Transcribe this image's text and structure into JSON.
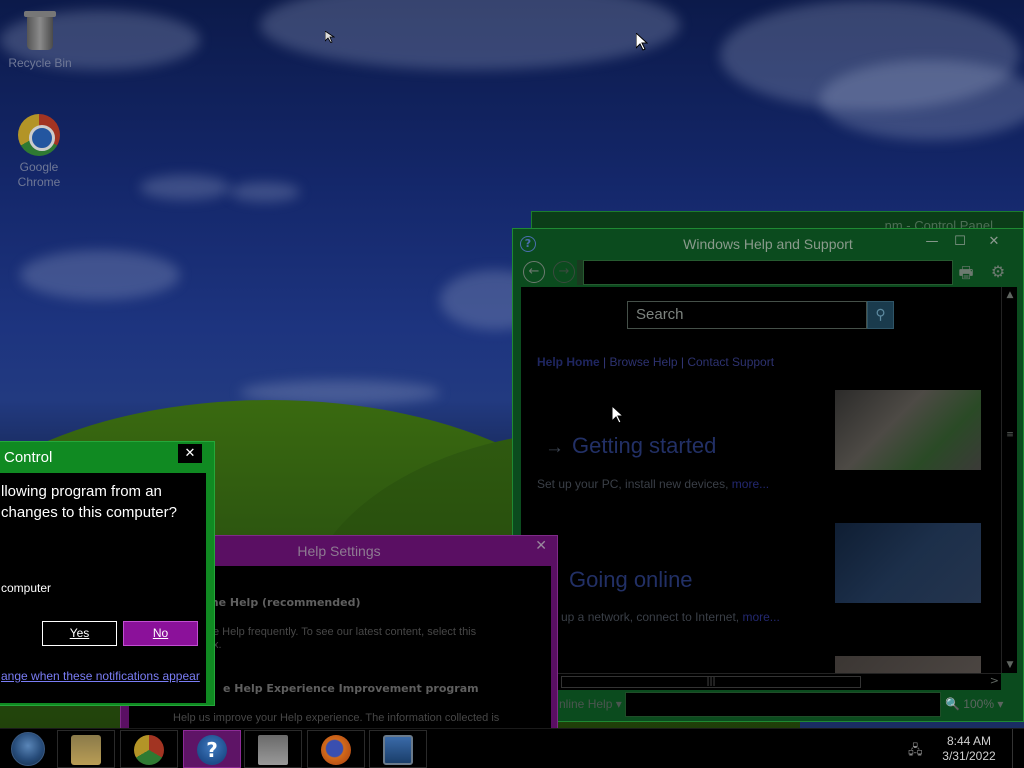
{
  "desktop": {
    "icons": [
      {
        "label": "Recycle Bin"
      },
      {
        "label": "Google Chrome"
      }
    ]
  },
  "control_panel": {
    "title": "nm - Control Panel"
  },
  "help_window": {
    "title": "Windows Help and Support",
    "search_placeholder": "Search",
    "links": {
      "home": "Help Home",
      "sep": "|",
      "browse": "Browse Help",
      "contact": "Contact Support"
    },
    "sections": [
      {
        "title": "Getting started",
        "desc": "Set up your PC, install new devices,",
        "more": "more..."
      },
      {
        "title": "Going online",
        "desc": "up a network, connect to Internet,",
        "more": "more..."
      }
    ],
    "status": {
      "online_help": "nline Help",
      "zoom": "100%"
    },
    "icons": {
      "help": "?",
      "back": "←",
      "forward": "→",
      "print": "🖶",
      "gear": "⚙",
      "search": "⚲",
      "minimize": "—",
      "maximize": "☐",
      "close": "✕",
      "arrow_up": "▲",
      "arrow_down": "▼",
      "arrow_right": ">",
      "scroll_grip": "|||",
      "vscroll_grip": "≡",
      "dropdown": "▾",
      "zoom": "🔍"
    }
  },
  "help_settings": {
    "title": "Help Settings",
    "close": "✕",
    "option1_heading": "ine Help (recommended)",
    "option1_text_line1": "e Help frequently. To see our latest content, select this",
    "option1_text_line2": "x.",
    "option2_heading": "e Help Experience Improvement program",
    "option2_text": "Help us improve your Help experience. The information collected is"
  },
  "uac": {
    "title": "Control",
    "close": "✕",
    "question_line1": "llowing program from an",
    "question_line2": "changes to this computer?",
    "computer_text": "computer",
    "yes_label": "Yes",
    "no_label": "No",
    "link": "ange when these notifications appear"
  },
  "taskbar": {
    "clock_time": "8:44 AM",
    "clock_date": "3/31/2022",
    "help_glyph": "?",
    "network": "🖧"
  }
}
